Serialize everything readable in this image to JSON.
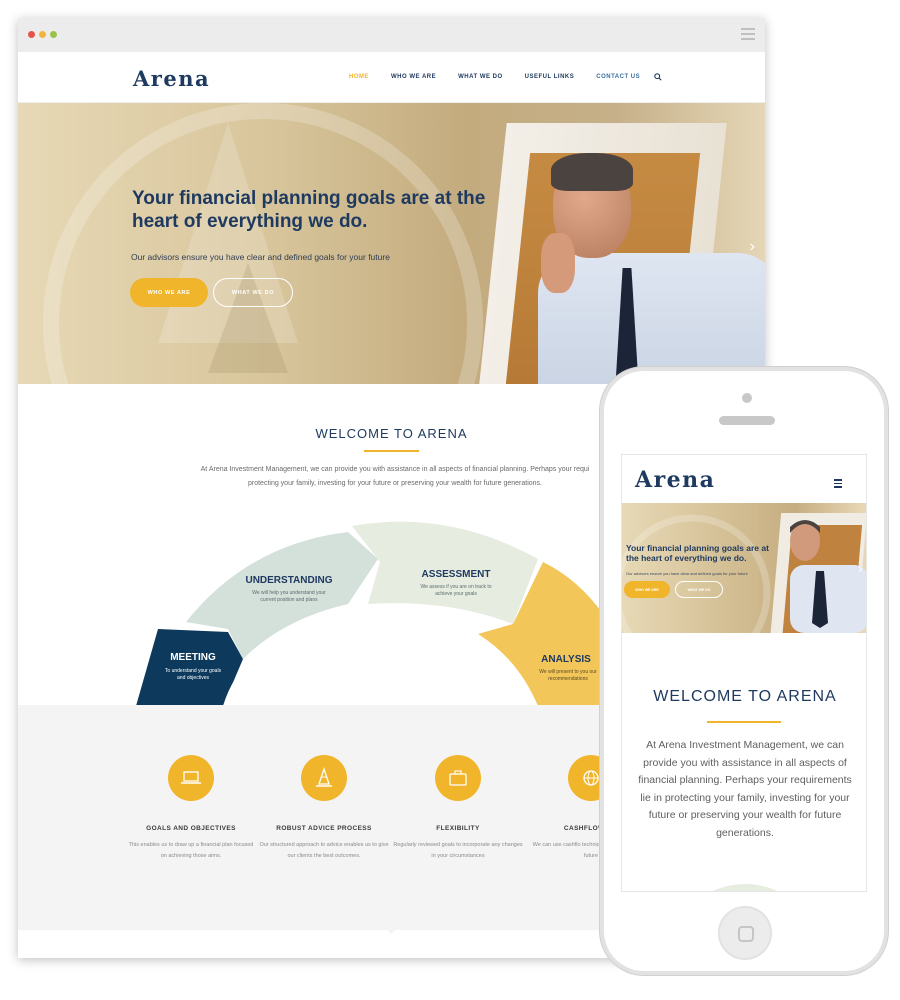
{
  "brand": {
    "name": "Arena",
    "primary": "#1f3a60",
    "accent": "#f1b52b"
  },
  "nav": {
    "items": [
      "HOME",
      "WHO WE ARE",
      "WHAT WE DO",
      "USEFUL LINKS",
      "CONTACT US"
    ],
    "active": "HOME",
    "search_icon": "search-icon"
  },
  "hero": {
    "title": "Your financial planning goals are at the heart of everything we do.",
    "subtitle": "Our advisors ensure you have clear and defined goals for your future",
    "btn_primary": "WHO WE ARE",
    "btn_secondary": "WHAT WE DO",
    "next_icon": "chevron-right-icon"
  },
  "welcome": {
    "title": "WELCOME TO ARENA",
    "text_line1": "At Arena Investment Management, we can provide you with assistance in all aspects of financial planning. Perhaps your requi",
    "text_line2": "protecting your family, investing for your future or preserving your wealth for future generations."
  },
  "process": [
    {
      "title": "MEETING",
      "desc": "To understand your goals and objectives",
      "color": "#0d3a5c"
    },
    {
      "title": "UNDERSTANDING",
      "desc": "We will help you understand your current position and plans",
      "color": "#d4e0da"
    },
    {
      "title": "ASSESSMENT",
      "desc": "We assess if you are on track to achieve your goals",
      "color": "#e7ece0"
    },
    {
      "title": "ANALYSIS",
      "desc": "We will present to you our recommendations",
      "color": "#f3c65a"
    }
  ],
  "features": [
    {
      "title": "GOALS AND OBJECTIVES",
      "desc": "This enables us to draw up a financial plan focused on achieving those aims.",
      "icon": "laptop-icon"
    },
    {
      "title": "ROBUST ADVICE PROCESS",
      "desc": "Our structured approach to advice enables us to give our clients the best outcomes.",
      "icon": "cone-icon"
    },
    {
      "title": "FLEXIBILITY",
      "desc": "Regularly reviewed goals to incorporate any changes in your circumstances",
      "icon": "briefcase-icon"
    },
    {
      "title": "CASHFLOW MO",
      "desc": "We can use cashflo techniques to dem potential future",
      "icon": "globe-icon"
    }
  ],
  "mobile": {
    "title": "Your financial planning goals are at the heart of everything we do.",
    "subtitle": "Our advisors ensure you have clear and defined goals for your future",
    "btn_primary": "WHO WE ARE",
    "btn_secondary": "WHAT WE DO",
    "welcome_title": "WELCOME TO ARENA",
    "welcome_text": "At Arena Investment Management, we can provide you with assistance in all aspects of financial planning. Perhaps your requirements lie in protecting your family, investing for your future or preserving your wealth for future generations.",
    "menu_icon": "hamburger-icon"
  }
}
